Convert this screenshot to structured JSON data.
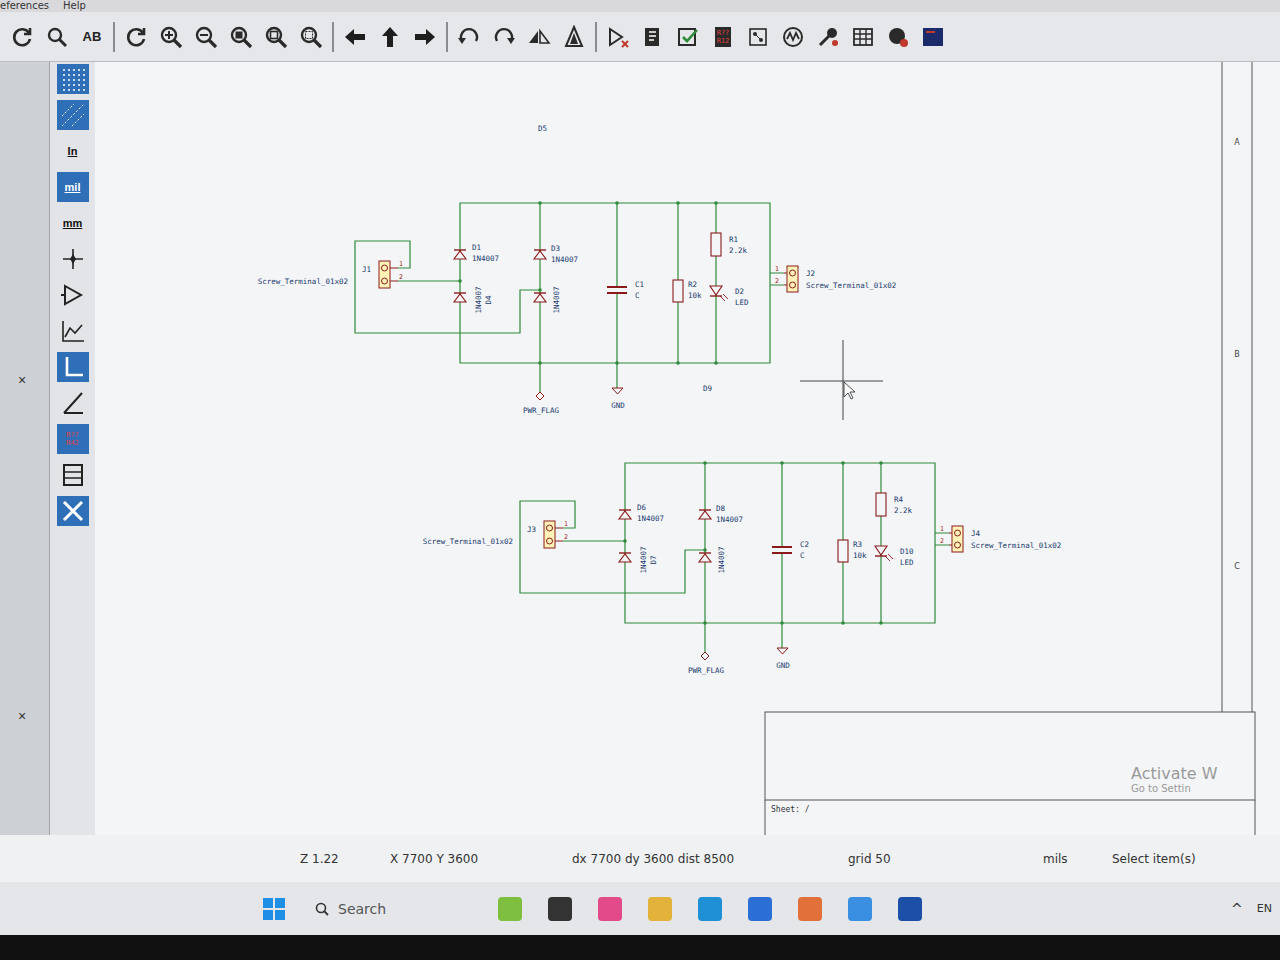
{
  "menu": [
    "eferences",
    "Help"
  ],
  "toolbar": [
    {
      "kind": "refresh"
    },
    {
      "kind": "find"
    },
    {
      "kind": "text",
      "label": "AB"
    },
    {
      "kind": "separator"
    },
    {
      "kind": "refresh"
    },
    {
      "kind": "zoom-in"
    },
    {
      "kind": "zoom-out"
    },
    {
      "kind": "zoom-fit"
    },
    {
      "kind": "zoom-object"
    },
    {
      "kind": "zoom-selection"
    },
    {
      "kind": "separator"
    },
    {
      "kind": "arrow-left"
    },
    {
      "kind": "arrow-up"
    },
    {
      "kind": "arrow-right"
    },
    {
      "kind": "separator"
    },
    {
      "kind": "rotate-left"
    },
    {
      "kind": "rotate-right"
    },
    {
      "kind": "mirror-h"
    },
    {
      "kind": "mirror-v"
    },
    {
      "kind": "separator"
    },
    {
      "kind": "symbol"
    },
    {
      "kind": "sheet"
    },
    {
      "kind": "check"
    },
    {
      "kind": "annotate",
      "label": "R??",
      "sublabel": "R12"
    },
    {
      "kind": "netlist"
    },
    {
      "kind": "simulate"
    },
    {
      "kind": "tool"
    },
    {
      "kind": "table"
    },
    {
      "kind": "globe"
    },
    {
      "kind": "panel"
    }
  ],
  "left_panel": {
    "close_marks": [
      "×",
      "×"
    ]
  },
  "left_toolbar": [
    {
      "kind": "grid",
      "selected": true
    },
    {
      "kind": "grid-alt",
      "selected": true
    },
    {
      "kind": "units",
      "label": "In",
      "selected": false
    },
    {
      "kind": "units",
      "label": "mil",
      "selected": true
    },
    {
      "kind": "units",
      "label": "mm",
      "selected": false
    },
    {
      "kind": "cursor",
      "selected": false
    },
    {
      "kind": "pin",
      "selected": false
    },
    {
      "kind": "graph",
      "selected": false
    },
    {
      "kind": "line",
      "selected": true
    },
    {
      "kind": "angle",
      "selected": false
    },
    {
      "kind": "annotate",
      "label": "R??",
      "sublabel": "R42",
      "selected": true
    },
    {
      "kind": "table",
      "selected": false
    },
    {
      "kind": "close",
      "selected": true
    }
  ],
  "schematic": {
    "blocks": [
      {
        "stray_label": "D5",
        "input": {
          "ref": "J1",
          "value": "Screw_Terminal_01x02",
          "pins": [
            "1",
            "2"
          ]
        },
        "diodes": [
          {
            "ref": "D1",
            "value": "1N4007"
          },
          {
            "ref": "D3",
            "value": "1N4007"
          },
          {
            "ref": "D4",
            "value": "1N4007"
          },
          {
            "value": "1N4007"
          }
        ],
        "capacitor": {
          "ref": "C1",
          "value": "C"
        },
        "bleed_resistor": {
          "ref": "R2",
          "value": "10k"
        },
        "led_resistor": {
          "ref": "R1",
          "value": "2.2k"
        },
        "led": {
          "ref": "D2",
          "value": "LED"
        },
        "output": {
          "ref": "J2",
          "value": "Screw_Terminal_01x02",
          "pins": [
            "1",
            "2"
          ]
        },
        "power_flag": "PWR_FLAG",
        "ground": "GND"
      },
      {
        "stray_label": "D9",
        "input": {
          "ref": "J3",
          "value": "Screw_Terminal_01x02",
          "pins": [
            "1",
            "2"
          ]
        },
        "diodes": [
          {
            "ref": "D6",
            "value": "1N4007"
          },
          {
            "ref": "D8",
            "value": "1N4007"
          },
          {
            "ref": "D7",
            "value": "1N4007"
          },
          {
            "value": "1N4007"
          }
        ],
        "capacitor": {
          "ref": "C2",
          "value": "C"
        },
        "bleed_resistor": {
          "ref": "R3",
          "value": "10k"
        },
        "led_resistor": {
          "ref": "R4",
          "value": "2.2k"
        },
        "led": {
          "ref": "D10",
          "value": "LED"
        },
        "output": {
          "ref": "J4",
          "value": "Screw_Terminal_01x02",
          "pins": [
            "1",
            "2"
          ]
        },
        "power_flag": "PWR_FLAG",
        "ground": "GND"
      }
    ]
  },
  "frame_letters": [
    "A",
    "B",
    "C"
  ],
  "title_block": {
    "sheet": "Sheet: /"
  },
  "watermark": {
    "title": "Activate W",
    "subtitle": "Go to Settin"
  },
  "status_bar": {
    "zoom": "Z 1.22",
    "position": "X 7700 Y 3600",
    "delta": "dx 7700 dy 3600 dist 8500",
    "grid": "grid 50",
    "units": "mils",
    "action": "Select item(s)"
  },
  "taskbar": {
    "search": "Search",
    "tray": "^",
    "language": "EN"
  }
}
